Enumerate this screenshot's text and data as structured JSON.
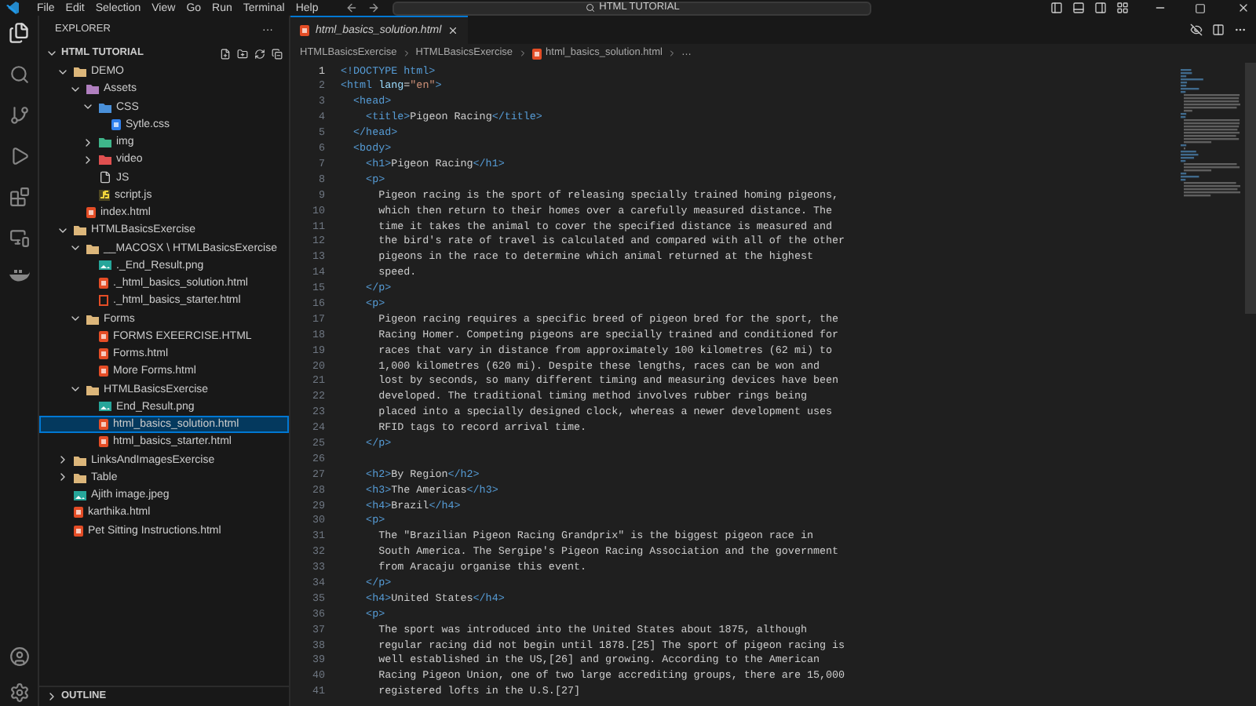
{
  "title_bar": {
    "menu": [
      "File",
      "Edit",
      "Selection",
      "View",
      "Go",
      "Run",
      "Terminal",
      "Help"
    ],
    "search": {
      "value": "HTML TUTORIAL"
    }
  },
  "sidebar": {
    "title": "EXPLORER",
    "more": "···",
    "section": "HTML TUTORIAL",
    "tree": [
      {
        "label": "DEMO",
        "kind": "folder",
        "expanded": true,
        "selected": false,
        "children": [
          {
            "label": "Assets",
            "kind": "assets-folder",
            "expanded": true,
            "selected": false,
            "children": [
              {
                "label": "CSS",
                "kind": "css-folder",
                "expanded": true,
                "selected": false,
                "children": [
                  {
                    "label": "Sytle.css",
                    "kind": "css",
                    "selected": false
                  }
                ]
              },
              {
                "label": "img",
                "kind": "img-folder",
                "expanded": false,
                "selected": false
              },
              {
                "label": "video",
                "kind": "video-folder",
                "expanded": false,
                "selected": false
              },
              {
                "label": "JS",
                "kind": "file",
                "selected": false
              },
              {
                "label": "script.js",
                "kind": "js",
                "selected": false
              }
            ]
          },
          {
            "label": "index.html",
            "kind": "html",
            "selected": false
          }
        ]
      },
      {
        "label": "HTMLBasicsExercise",
        "kind": "folder",
        "expanded": true,
        "selected": false,
        "children": [
          {
            "label": "__MACOSX \\ HTMLBasicsExercise",
            "kind": "folder",
            "expanded": true,
            "selected": false,
            "children": [
              {
                "label": "._End_Result.png",
                "kind": "image",
                "selected": false
              },
              {
                "label": "._html_basics_solution.html",
                "kind": "html",
                "selected": false
              },
              {
                "label": "._html_basics_starter.html",
                "kind": "html-outline",
                "selected": false
              }
            ]
          },
          {
            "label": "Forms",
            "kind": "folder",
            "expanded": true,
            "selected": false,
            "children": [
              {
                "label": "FORMS EXEERCISE.HTML",
                "kind": "html",
                "selected": false
              },
              {
                "label": "Forms.html",
                "kind": "html",
                "selected": false
              },
              {
                "label": "More Forms.html",
                "kind": "html",
                "selected": false
              }
            ]
          },
          {
            "label": "HTMLBasicsExercise",
            "kind": "folder",
            "expanded": true,
            "selected": false,
            "children": [
              {
                "label": "End_Result.png",
                "kind": "image",
                "selected": false
              },
              {
                "label": "html_basics_solution.html",
                "kind": "html",
                "selected": true
              },
              {
                "label": "html_basics_starter.html",
                "kind": "html",
                "selected": false
              }
            ]
          }
        ]
      },
      {
        "label": "LinksAndImagesExercise",
        "kind": "folder",
        "expanded": false,
        "selected": false
      },
      {
        "label": "Table",
        "kind": "folder",
        "expanded": false,
        "selected": false
      },
      {
        "label": "Ajith image.jpeg",
        "kind": "image",
        "selected": false
      },
      {
        "label": "karthika.html",
        "kind": "html",
        "selected": false
      },
      {
        "label": "Pet Sitting Instructions.html",
        "kind": "html",
        "selected": false
      }
    ],
    "panels": [
      {
        "label": "OUTLINE",
        "expanded": false
      }
    ]
  },
  "editor": {
    "tabs": [
      {
        "label": "html_basics_solution.html",
        "selected": true
      }
    ],
    "breadcrumb": [
      "HTMLBasicsExercise",
      "HTMLBasicsExercise",
      "html_basics_solution.html",
      "…"
    ],
    "lines": [
      {
        "n": "1",
        "current": true,
        "t": [
          {
            "kind": "tag",
            "text": "<!DOCTYPE html>"
          }
        ]
      },
      {
        "n": "2",
        "current": false,
        "t": [
          {
            "kind": "tag",
            "text": "<html"
          },
          {
            "kind": "attr",
            "text": " lang"
          },
          {
            "kind": "text",
            "text": "="
          },
          {
            "kind": "string",
            "text": "\"en\""
          },
          {
            "kind": "tag",
            "text": ">"
          }
        ]
      },
      {
        "n": "3",
        "current": false,
        "t": [
          {
            "kind": "tag",
            "text": "  <head>"
          }
        ]
      },
      {
        "n": "4",
        "current": false,
        "t": [
          {
            "kind": "tag",
            "text": "    <title>"
          },
          {
            "kind": "text",
            "text": "Pigeon Racing"
          },
          {
            "kind": "tag",
            "text": "</title>"
          }
        ]
      },
      {
        "n": "5",
        "current": false,
        "t": [
          {
            "kind": "tag",
            "text": "  </head>"
          }
        ]
      },
      {
        "n": "6",
        "current": false,
        "t": [
          {
            "kind": "tag",
            "text": "  <body>"
          }
        ]
      },
      {
        "n": "7",
        "current": false,
        "t": [
          {
            "kind": "tag",
            "text": "    <h1>"
          },
          {
            "kind": "text",
            "text": "Pigeon Racing"
          },
          {
            "kind": "tag",
            "text": "</h1>"
          }
        ]
      },
      {
        "n": "8",
        "current": false,
        "t": [
          {
            "kind": "tag",
            "text": "    <p>"
          }
        ]
      },
      {
        "n": "9",
        "current": false,
        "t": [
          {
            "kind": "text",
            "text": "      Pigeon racing is the sport of releasing specially trained homing pigeons,"
          }
        ]
      },
      {
        "n": "10",
        "current": false,
        "t": [
          {
            "kind": "text",
            "text": "      which then return to their homes over a carefully measured distance. The"
          }
        ]
      },
      {
        "n": "11",
        "current": false,
        "t": [
          {
            "kind": "text",
            "text": "      time it takes the animal to cover the specified distance is measured and"
          }
        ]
      },
      {
        "n": "12",
        "current": false,
        "t": [
          {
            "kind": "text",
            "text": "      the bird's rate of travel is calculated and compared with all of the other"
          }
        ]
      },
      {
        "n": "13",
        "current": false,
        "t": [
          {
            "kind": "text",
            "text": "      pigeons in the race to determine which animal returned at the highest"
          }
        ]
      },
      {
        "n": "14",
        "current": false,
        "t": [
          {
            "kind": "text",
            "text": "      speed."
          }
        ]
      },
      {
        "n": "15",
        "current": false,
        "t": [
          {
            "kind": "tag",
            "text": "    </p>"
          }
        ]
      },
      {
        "n": "16",
        "current": false,
        "t": [
          {
            "kind": "tag",
            "text": "    <p>"
          }
        ]
      },
      {
        "n": "17",
        "current": false,
        "t": [
          {
            "kind": "text",
            "text": "      Pigeon racing requires a specific breed of pigeon bred for the sport, the"
          }
        ]
      },
      {
        "n": "18",
        "current": false,
        "t": [
          {
            "kind": "text",
            "text": "      Racing Homer. Competing pigeons are specially trained and conditioned for"
          }
        ]
      },
      {
        "n": "19",
        "current": false,
        "t": [
          {
            "kind": "text",
            "text": "      races that vary in distance from approximately 100 kilometres (62 mi) to"
          }
        ]
      },
      {
        "n": "20",
        "current": false,
        "t": [
          {
            "kind": "text",
            "text": "      1,000 kilometres (620 mi). Despite these lengths, races can be won and"
          }
        ]
      },
      {
        "n": "21",
        "current": false,
        "t": [
          {
            "kind": "text",
            "text": "      lost by seconds, so many different timing and measuring devices have been"
          }
        ]
      },
      {
        "n": "22",
        "current": false,
        "t": [
          {
            "kind": "text",
            "text": "      developed. The traditional timing method involves rubber rings being"
          }
        ]
      },
      {
        "n": "23",
        "current": false,
        "t": [
          {
            "kind": "text",
            "text": "      placed into a specially designed clock, whereas a newer development uses"
          }
        ]
      },
      {
        "n": "24",
        "current": false,
        "t": [
          {
            "kind": "text",
            "text": "      RFID tags to record arrival time."
          }
        ]
      },
      {
        "n": "25",
        "current": false,
        "t": [
          {
            "kind": "tag",
            "text": "    </p>"
          }
        ]
      },
      {
        "n": "26",
        "current": false
      },
      {
        "n": "27",
        "current": false,
        "t": [
          {
            "kind": "tag",
            "text": "    <h2>"
          },
          {
            "kind": "text",
            "text": "By Region"
          },
          {
            "kind": "tag",
            "text": "</h2>"
          }
        ]
      },
      {
        "n": "28",
        "current": false,
        "t": [
          {
            "kind": "tag",
            "text": "    <h3>"
          },
          {
            "kind": "text",
            "text": "The Americas"
          },
          {
            "kind": "tag",
            "text": "</h3>"
          }
        ]
      },
      {
        "n": "29",
        "current": false,
        "t": [
          {
            "kind": "tag",
            "text": "    <h4>"
          },
          {
            "kind": "text",
            "text": "Brazil"
          },
          {
            "kind": "tag",
            "text": "</h4>"
          }
        ]
      },
      {
        "n": "30",
        "current": false,
        "t": [
          {
            "kind": "tag",
            "text": "    <p>"
          }
        ]
      },
      {
        "n": "31",
        "current": false,
        "t": [
          {
            "kind": "text",
            "text": "      The \"Brazilian Pigeon Racing Grandprix\" is the biggest pigeon race in"
          }
        ]
      },
      {
        "n": "32",
        "current": false,
        "t": [
          {
            "kind": "text",
            "text": "      South America. The Sergipe's Pigeon Racing Association and the government"
          }
        ]
      },
      {
        "n": "33",
        "current": false,
        "t": [
          {
            "kind": "text",
            "text": "      from Aracaju organise this event."
          }
        ]
      },
      {
        "n": "34",
        "current": false,
        "t": [
          {
            "kind": "tag",
            "text": "    </p>"
          }
        ]
      },
      {
        "n": "35",
        "current": false,
        "t": [
          {
            "kind": "tag",
            "text": "    <h4>"
          },
          {
            "kind": "text",
            "text": "United States"
          },
          {
            "kind": "tag",
            "text": "</h4>"
          }
        ]
      },
      {
        "n": "36",
        "current": false,
        "t": [
          {
            "kind": "tag",
            "text": "    <p>"
          }
        ]
      },
      {
        "n": "37",
        "current": false,
        "t": [
          {
            "kind": "text",
            "text": "      The sport was introduced into the United States about 1875, although"
          }
        ]
      },
      {
        "n": "38",
        "current": false,
        "t": [
          {
            "kind": "text",
            "text": "      regular racing did not begin until 1878.[25] The sport of pigeon racing is"
          }
        ]
      },
      {
        "n": "39",
        "current": false,
        "t": [
          {
            "kind": "text",
            "text": "      well established in the US,[26] and growing. According to the American"
          }
        ]
      },
      {
        "n": "40",
        "current": false,
        "t": [
          {
            "kind": "text",
            "text": "      Racing Pigeon Union, one of two large accrediting groups, there are 15,000"
          }
        ]
      },
      {
        "n": "41",
        "current": false,
        "t": [
          {
            "kind": "text",
            "text": "      registered lofts in the U.S.[27]"
          }
        ]
      }
    ]
  }
}
